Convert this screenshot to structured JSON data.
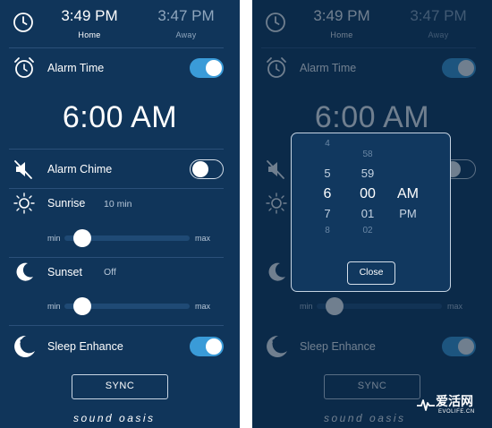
{
  "times": {
    "home_time": "3:49 PM",
    "home_label": "Home",
    "away_time": "3:47 PM",
    "away_label": "Away"
  },
  "alarm": {
    "label": "Alarm Time",
    "enabled": true,
    "time": "6:00 AM"
  },
  "chime": {
    "label": "Alarm Chime",
    "enabled": false
  },
  "sunrise": {
    "label": "Sunrise",
    "value": "10 min",
    "slider_level": 0.08,
    "min_label": "min",
    "max_label": "max"
  },
  "sunset": {
    "label": "Sunset",
    "value": "Off",
    "slider_level": 0.08,
    "min_label": "min",
    "max_label": "max"
  },
  "sleep": {
    "label": "Sleep Enhance",
    "enabled": true,
    "icon_text": "SE"
  },
  "sync_label": "SYNC",
  "brand": "sound oasis",
  "picker": {
    "hours": [
      "4",
      "5",
      "6",
      "7",
      "8"
    ],
    "minutes": [
      "58",
      "59",
      "00",
      "01",
      "02"
    ],
    "ampm": [
      "AM",
      "PM"
    ],
    "close_label": "Close"
  },
  "watermark": {
    "main": "爱活网",
    "sub": "EVOLIFE.CN"
  },
  "colors": {
    "background": "#10355a",
    "toggle_on": "#3a9bd8",
    "divider": "#2b5079"
  }
}
